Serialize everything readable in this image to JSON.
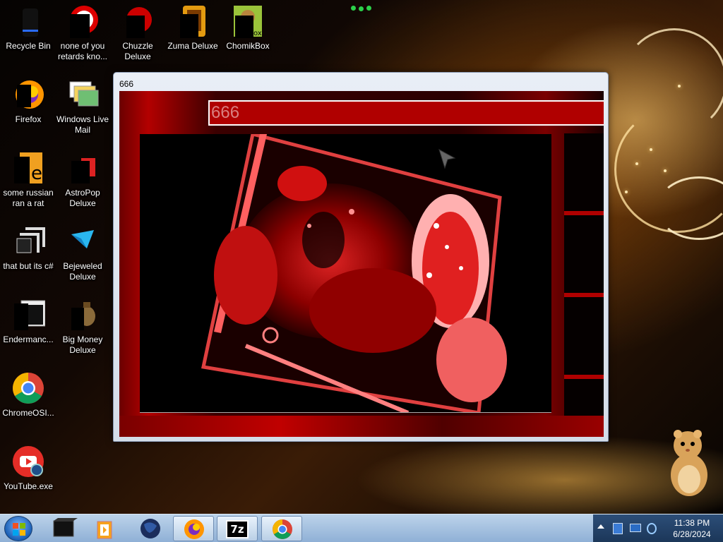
{
  "desktop": {
    "icons": [
      {
        "label": "Recycle Bin",
        "icon": "recycle-bin-icon"
      },
      {
        "label": "none of you retards kno...",
        "icon": "red-shortcut-icon"
      },
      {
        "label": "Chuzzle Deluxe",
        "icon": "chuzzle-icon"
      },
      {
        "label": "Zuma Deluxe",
        "icon": "zuma-icon"
      },
      {
        "label": "ChomikBox",
        "icon": "chomikbox-icon"
      },
      {
        "label": "Firefox",
        "icon": "firefox-icon"
      },
      {
        "label": "Windows Live Mail",
        "icon": "windows-live-mail-icon"
      },
      {
        "label": "some russian ran a rat",
        "icon": "exe-file-icon"
      },
      {
        "label": "AstroPop Deluxe",
        "icon": "astropop-icon"
      },
      {
        "label": "that but its c#",
        "icon": "shortcut-icon"
      },
      {
        "label": "Bejeweled Deluxe",
        "icon": "bejeweled-icon"
      },
      {
        "label": "Endermanc...",
        "icon": "app-window-icon"
      },
      {
        "label": "Big Money Deluxe",
        "icon": "money-bag-icon"
      },
      {
        "label": "ChromeOSI...",
        "icon": "chrome-icon"
      },
      {
        "label": "YouTube.exe",
        "icon": "youtube-icon"
      }
    ]
  },
  "window": {
    "title": "666",
    "field_text": "666"
  },
  "taskbar": {
    "pinned": [
      {
        "icon": "windows-start-icon"
      },
      {
        "icon": "black-box-app-icon"
      },
      {
        "icon": "media-player-icon"
      },
      {
        "icon": "globe-icon"
      },
      {
        "icon": "firefox-icon"
      },
      {
        "icon": "7zip-icon",
        "label": "7z"
      },
      {
        "icon": "chrome-icon"
      }
    ],
    "clock": {
      "time": "11:38 PM",
      "date": "6/28/2024"
    }
  },
  "colors": {
    "window_red": "#b00000",
    "taskbar_blue": "#8fb0d6",
    "field_text": "#d98080"
  }
}
